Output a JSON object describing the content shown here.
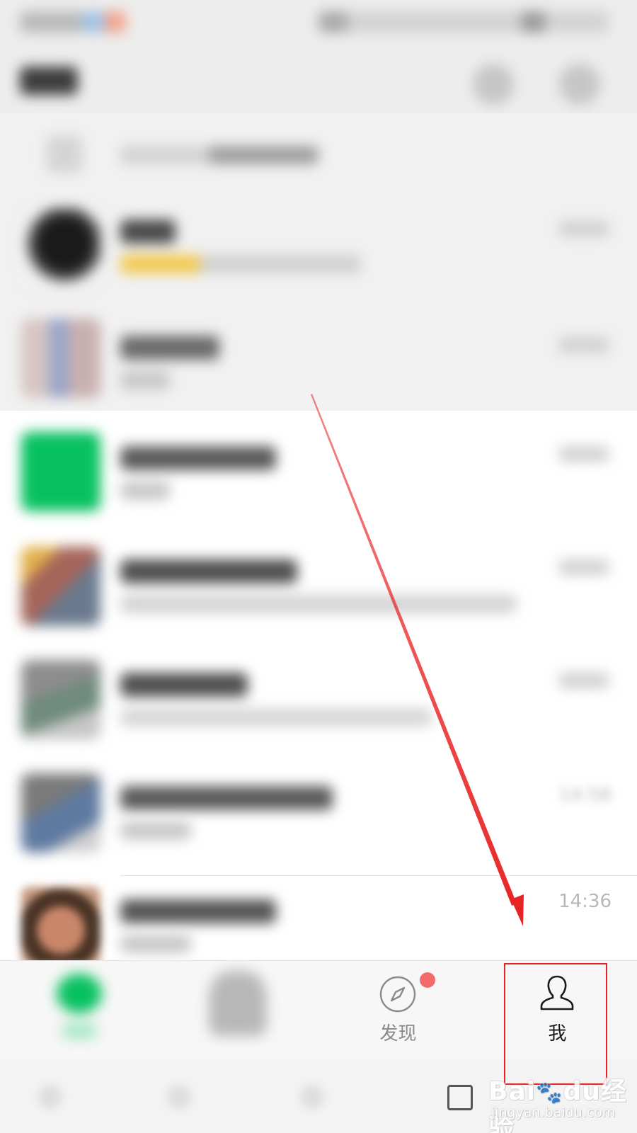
{
  "status_bar": {},
  "header": {
    "search_icon": "search-icon",
    "add_icon": "plus-circle-icon"
  },
  "chat_list": {
    "visible_times": [
      "14:58",
      "14:36"
    ]
  },
  "tabbar": {
    "tabs": [
      {
        "label": "",
        "icon": "chat-bubble-icon"
      },
      {
        "label": "",
        "icon": "contacts-icon"
      },
      {
        "label": "发现",
        "icon": "compass-icon",
        "badge": "red-dot"
      },
      {
        "label": "我",
        "icon": "person-icon"
      }
    ]
  },
  "annotation": {
    "color": "#e82323",
    "target": "tab-me"
  },
  "watermark": {
    "main": "Bai",
    "paw": "du",
    "brand": "经验",
    "url": "jingyan.baidu.com"
  },
  "colors": {
    "wechat_green": "#07c160",
    "badge_red": "#f36b6b",
    "tab_text": "#888888"
  }
}
